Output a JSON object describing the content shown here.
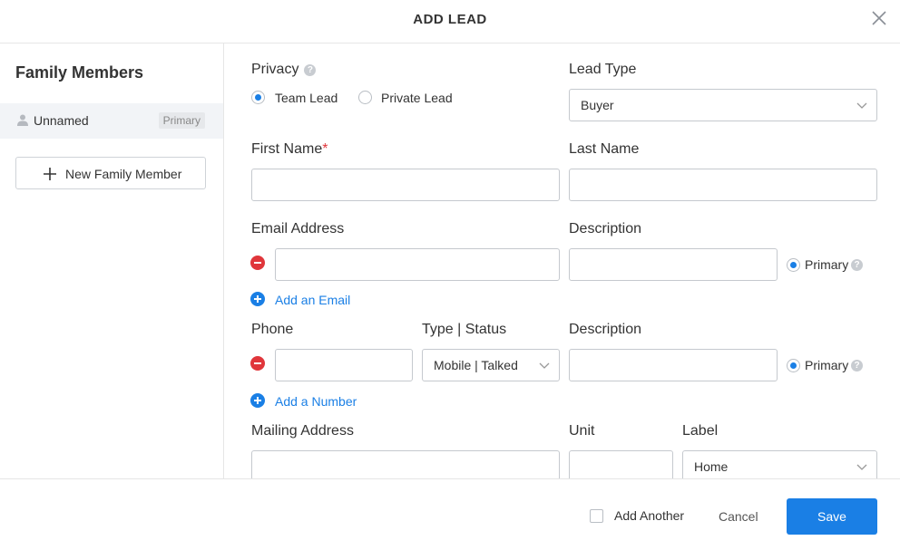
{
  "header": {
    "title": "ADD LEAD",
    "close_icon": "close-icon"
  },
  "sidebar": {
    "title": "Family Members",
    "member": {
      "name": "Unnamed",
      "badge": "Primary",
      "icon": "person-icon"
    },
    "new_member_label": "New Family Member"
  },
  "form": {
    "privacy": {
      "label": "Privacy",
      "help": "?",
      "options": [
        {
          "label": "Team Lead",
          "selected": true
        },
        {
          "label": "Private Lead",
          "selected": false
        }
      ]
    },
    "lead_type": {
      "label": "Lead Type",
      "value": "Buyer"
    },
    "first_name": {
      "label": "First Name",
      "required_mark": "*",
      "value": ""
    },
    "last_name": {
      "label": "Last Name",
      "value": ""
    },
    "email": {
      "label": "Email Address",
      "value": "",
      "description_label": "Description",
      "description_value": "",
      "primary_label": "Primary",
      "primary_selected": true,
      "add_label": "Add an Email"
    },
    "phone": {
      "label": "Phone",
      "value": "",
      "type_status_label": "Type | Status",
      "type_status_value": "Mobile | Talked",
      "description_label": "Description",
      "description_value": "",
      "primary_label": "Primary",
      "primary_selected": true,
      "add_label": "Add a Number"
    },
    "mailing": {
      "label": "Mailing Address",
      "value": "",
      "unit_label": "Unit",
      "unit_value": "",
      "label_label": "Label",
      "label_value": "Home"
    }
  },
  "footer": {
    "add_another_label": "Add Another",
    "add_another_checked": false,
    "cancel_label": "Cancel",
    "save_label": "Save"
  },
  "colors": {
    "accent": "#1a7fe5",
    "danger": "#e0363b",
    "border": "#c5c9ce"
  }
}
